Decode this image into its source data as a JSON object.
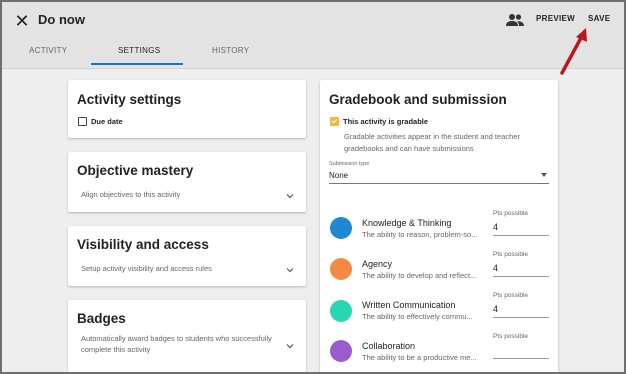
{
  "header": {
    "close_icon": "close-icon",
    "title": "Do now",
    "people_icon": "people-icon",
    "preview_label": "PREVIEW",
    "save_label": "SAVE"
  },
  "tabs": [
    {
      "label": "ACTIVITY",
      "active": false
    },
    {
      "label": "SETTINGS",
      "active": true
    },
    {
      "label": "HISTORY",
      "active": false
    }
  ],
  "left_cards": {
    "activity_settings": {
      "title": "Activity settings",
      "due_date_label": "Due date",
      "due_date_checked": false
    },
    "objective_mastery": {
      "title": "Objective mastery",
      "subtitle": "Align objectives to this activity"
    },
    "visibility": {
      "title": "Visibility and access",
      "subtitle": "Setup activity visibility and access rules"
    },
    "badges": {
      "title": "Badges",
      "subtitle_line1": "Automatically award badges to students who successfully",
      "subtitle_line2": "complete this activity"
    }
  },
  "gradebook": {
    "title": "Gradebook and submission",
    "gradable_label": "This activity is gradable",
    "gradable_checked": true,
    "gradable_desc_line1": "Gradable activities appear in the student and teacher",
    "gradable_desc_line2": "gradebooks and can have submissions",
    "submission_type_label": "Submission type",
    "submission_type_value": "None",
    "criteria": [
      {
        "name": "Knowledge & Thinking",
        "desc": "The ability to reason, problem-so...",
        "pts_label": "Pts possible",
        "pts": "4",
        "color": "#1e88d4"
      },
      {
        "name": "Agency",
        "desc": "The ability to develop and reflect...",
        "pts_label": "Pts possible",
        "pts": "4",
        "color": "#f58a44"
      },
      {
        "name": "Written Communication",
        "desc": "The ability to effectively commu...",
        "pts_label": "Pts possible",
        "pts": "4",
        "color": "#27d6b4"
      },
      {
        "name": "Collaboration",
        "desc": "The ability to be a productive me...",
        "pts_label": "Pts possible",
        "pts": "",
        "color": "#9a5ccc"
      }
    ]
  },
  "accent_color": "#1a73c8",
  "annotation_arrow_color": "#b8181e"
}
